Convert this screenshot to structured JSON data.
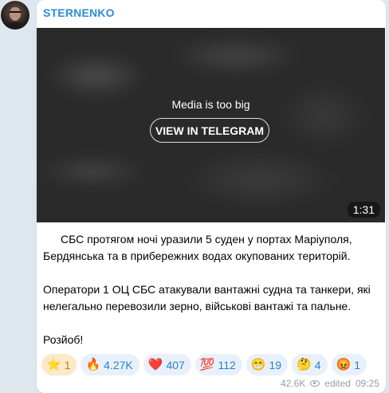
{
  "channel": {
    "name": "STERNENKO"
  },
  "media": {
    "message": "Media is too big",
    "button_label": "VIEW IN TELEGRAM",
    "duration": "1:31"
  },
  "post": {
    "paragraphs": [
      "СБС протягом ночі уразили 5 суден у портах Маріуполя, Бердянська та в прибережних водах окупованих територій.",
      "Оператори 1 ОЦ СБС атакували вантажні судна та танкери, які нелегально перевозили зерно, військові вантажі та пальне.",
      "Розйоб!"
    ]
  },
  "reactions": [
    {
      "emoji": "⭐",
      "count": "1",
      "name": "star"
    },
    {
      "emoji": "🔥",
      "count": "4.27K",
      "name": "fire"
    },
    {
      "emoji": "❤️",
      "count": "407",
      "name": "heart"
    },
    {
      "emoji": "💯",
      "count": "112",
      "name": "hundred"
    },
    {
      "emoji": "😁",
      "count": "19",
      "name": "grin"
    },
    {
      "emoji": "🤔",
      "count": "4",
      "name": "thinking"
    },
    {
      "emoji": "😡",
      "count": "1",
      "name": "angry"
    }
  ],
  "footer": {
    "views": "42.6K",
    "edited": "edited",
    "time": "09:25"
  },
  "colors": {
    "background": "#dfe7ee",
    "author": "#2d8bd6",
    "reaction_bg": "#e8f1fb",
    "reaction_count": "#2d7fc8"
  }
}
